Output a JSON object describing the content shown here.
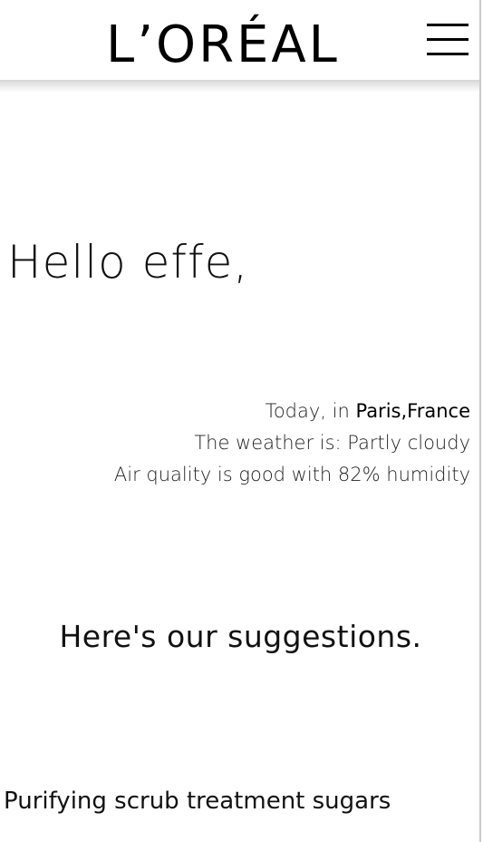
{
  "header": {
    "logo_text": "L’ORÉAL",
    "menu_icon": "hamburger-menu-icon"
  },
  "greeting": {
    "text": "Hello effe,"
  },
  "weather": {
    "today_prefix": "Today, in ",
    "city": "Paris",
    "separator": ",",
    "country": "France",
    "condition_line": "The weather is: Partly cloudy",
    "air_quality_line": "Air quality is good with 82% humidity"
  },
  "suggestions": {
    "heading": "Here's our suggestions.",
    "items": [
      {
        "title": "Purifying scrub treatment sugars"
      }
    ]
  },
  "colors": {
    "text": "#111111",
    "background": "#ffffff",
    "logo": "#000000"
  }
}
